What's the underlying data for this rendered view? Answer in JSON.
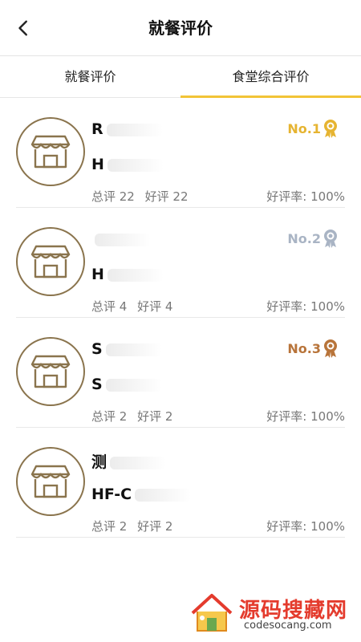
{
  "header": {
    "title": "就餐评价",
    "back_icon": "chevron-left-icon"
  },
  "tabs": [
    {
      "label": "就餐评价",
      "active": false
    },
    {
      "label": "食堂综合评价",
      "active": true
    }
  ],
  "colors": {
    "accent": "#f2c436",
    "avatar_border": "#8a744d",
    "gold": "#e6b431",
    "silver": "#a9b4c4",
    "bronze": "#b8743a"
  },
  "canteens": [
    {
      "name": "R",
      "code": "H",
      "total_label": "总评 22",
      "good_label": "好评 22",
      "rate_label": "好评率: 100%",
      "rank": "No.1",
      "rank_color": "#e6b431"
    },
    {
      "name": "",
      "code": "H",
      "total_label": "总评 4",
      "good_label": "好评 4",
      "rate_label": "好评率: 100%",
      "rank": "No.2",
      "rank_color": "#a9b4c4"
    },
    {
      "name": "S",
      "code": "S",
      "total_label": "总评 2",
      "good_label": "好评 2",
      "rate_label": "好评率: 100%",
      "rank": "No.3",
      "rank_color": "#b8743a"
    },
    {
      "name": "测",
      "code": "HF-C",
      "total_label": "总评 2",
      "good_label": "好评 2",
      "rate_label": "好评率: 100%",
      "rank": "",
      "rank_color": ""
    }
  ],
  "watermark": {
    "title": "源码搜藏网",
    "url": "codesocang.com"
  }
}
